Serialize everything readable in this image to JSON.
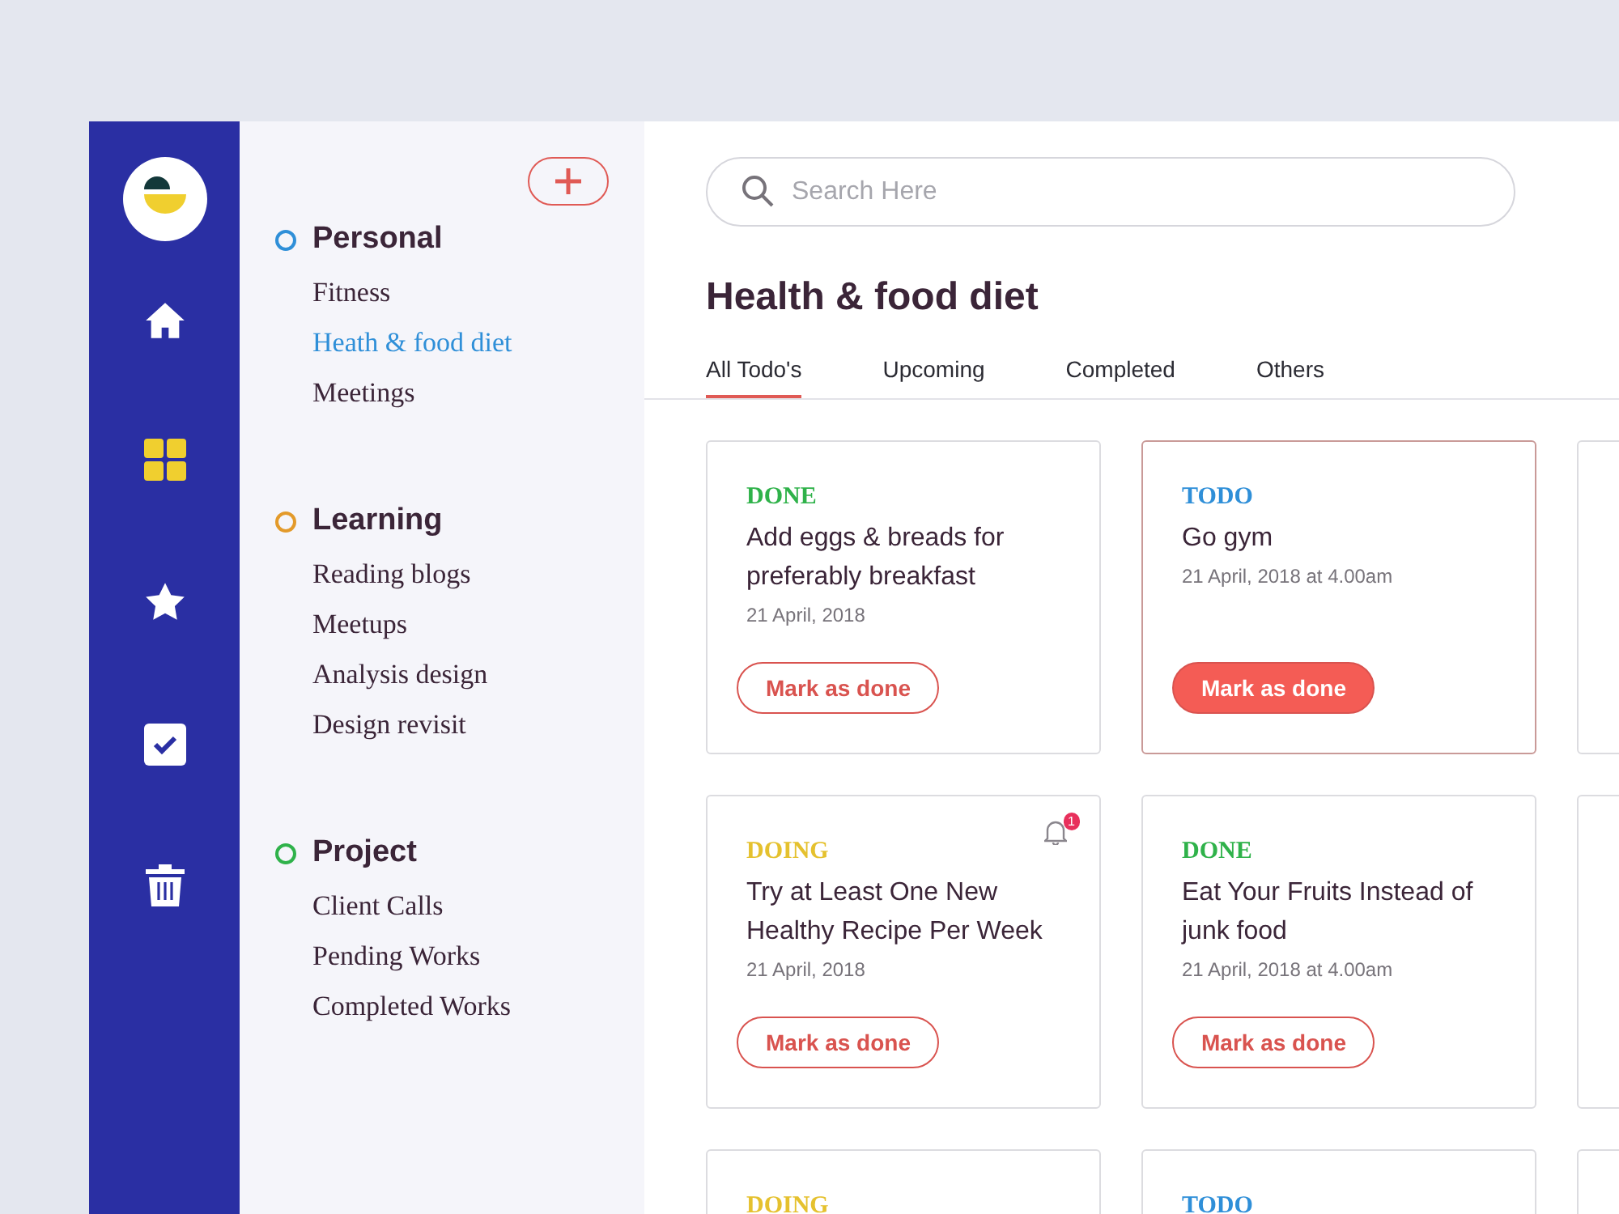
{
  "sidebar": {
    "groups": [
      {
        "title": "Personal",
        "color": "#2f8fd8",
        "items": [
          {
            "label": "Fitness",
            "selected": false
          },
          {
            "label": "Heath & food diet",
            "selected": true
          },
          {
            "label": "Meetings",
            "selected": false
          }
        ]
      },
      {
        "title": "Learning",
        "color": "#e39a2a",
        "items": [
          {
            "label": "Reading blogs",
            "selected": false
          },
          {
            "label": "Meetups",
            "selected": false
          },
          {
            "label": "Analysis design",
            "selected": false
          },
          {
            "label": "Design revisit",
            "selected": false
          }
        ]
      },
      {
        "title": "Project",
        "color": "#2fb24a",
        "items": [
          {
            "label": "Client Calls",
            "selected": false
          },
          {
            "label": "Pending Works",
            "selected": false
          },
          {
            "label": "Completed Works",
            "selected": false
          }
        ]
      }
    ]
  },
  "search": {
    "placeholder": "Search Here"
  },
  "title": "Health & food diet",
  "tabs": [
    {
      "label": "All Todo's",
      "selected": true
    },
    {
      "label": "Upcoming",
      "selected": false
    },
    {
      "label": "Completed",
      "selected": false
    },
    {
      "label": "Others",
      "selected": false
    }
  ],
  "card_rows": [
    {
      "cards": [
        {
          "status": "DONE",
          "color": "#2fb24a",
          "title": "Add eggs & breads for preferably breakfast",
          "date": "21 April, 2018",
          "button": "Mark as done",
          "selected": false
        },
        {
          "status": "TODO",
          "color": "#2f8fd8",
          "title": "Go gym",
          "date": "21 April, 2018 at 4.00am",
          "button": "Mark as done",
          "selected": true
        }
      ]
    },
    {
      "cards": [
        {
          "status": "DOING",
          "color": "#e5c12e",
          "title": "Try at Least One New Healthy Recipe Per Week",
          "date": "21 April, 2018",
          "button": "Mark as done",
          "selected": false,
          "notifications": "1"
        },
        {
          "status": "DONE",
          "color": "#2fb24a",
          "title": "Eat Your Fruits Instead of junk food",
          "date": "21 April, 2018 at 4.00am",
          "button": "Mark as done",
          "selected": false
        }
      ]
    },
    {
      "cards": [
        {
          "status": "DOING",
          "color": "#e5c12e"
        },
        {
          "status": "TODO",
          "color": "#2f8fd8"
        }
      ]
    }
  ]
}
